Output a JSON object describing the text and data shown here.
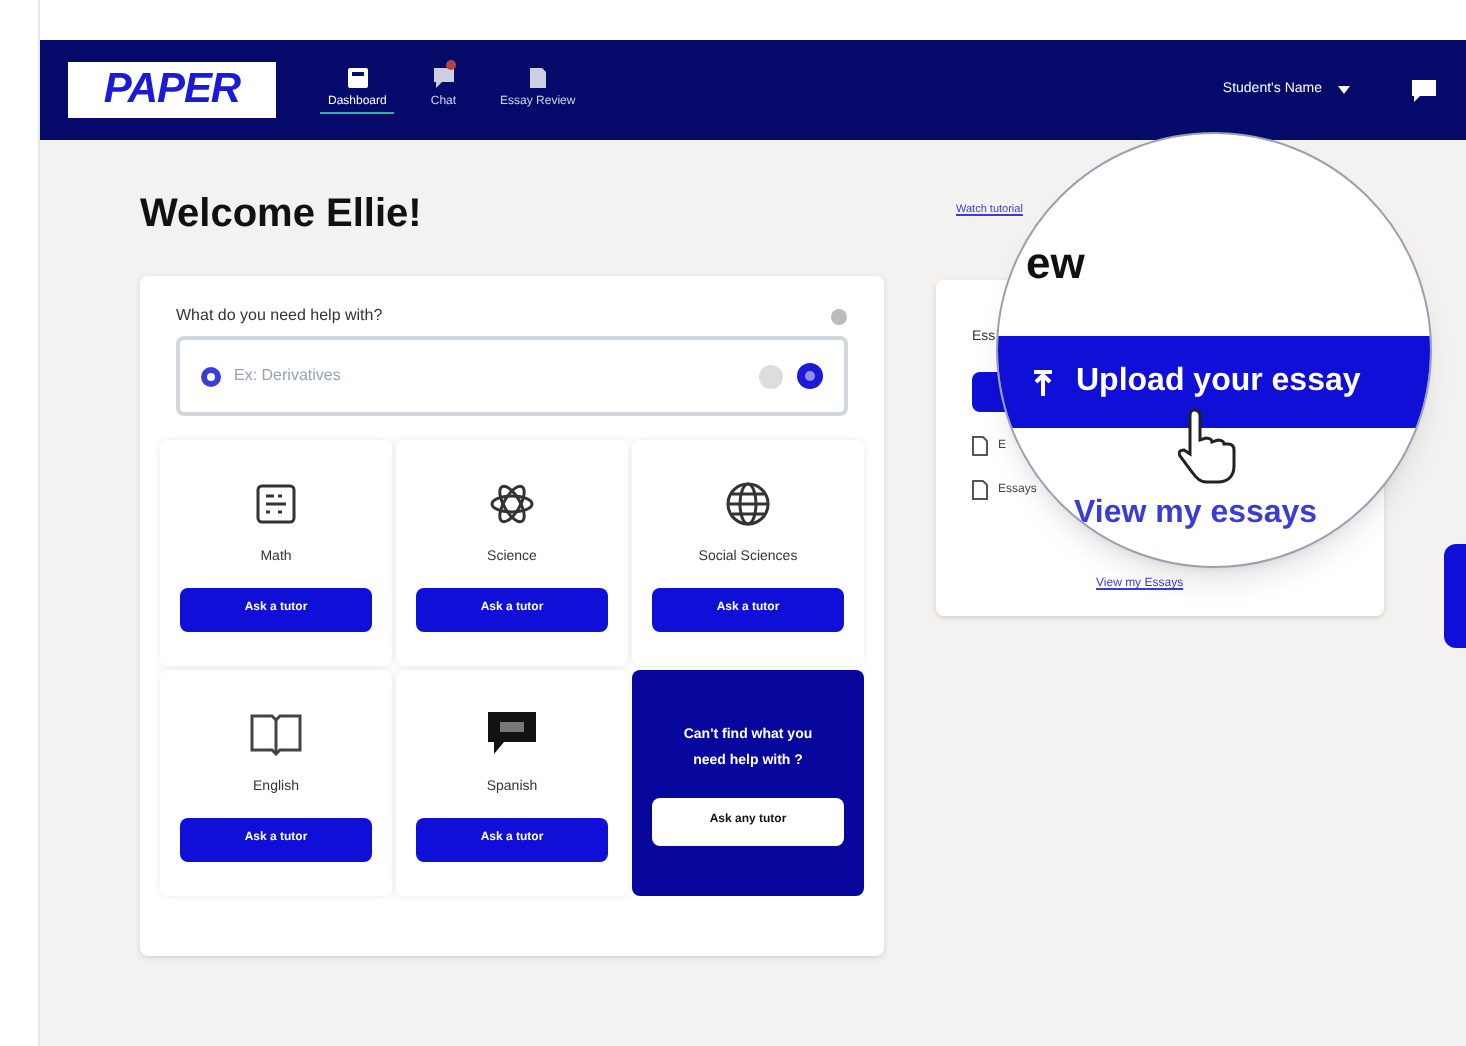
{
  "nav": {
    "logo": "PAPER",
    "items": [
      {
        "label": "Dashboard",
        "selected": true,
        "badge": false,
        "kind": "home"
      },
      {
        "label": "Chat",
        "selected": false,
        "badge": true,
        "kind": "chat"
      },
      {
        "label": "Essay Review",
        "selected": false,
        "badge": false,
        "kind": "doc"
      }
    ],
    "user_menu": "Student's Name"
  },
  "welcome": "Welcome Ellie!",
  "help": {
    "prompt": "What do you need help with?",
    "placeholder": "Ex: Derivatives",
    "subjects": [
      {
        "name": "Math",
        "button": "Ask a tutor",
        "kind": "math"
      },
      {
        "name": "Science",
        "button": "Ask a tutor",
        "kind": "science"
      },
      {
        "name": "Social Sciences",
        "button": "Ask a tutor",
        "kind": "globe"
      },
      {
        "name": "English",
        "button": "Ask a tutor",
        "kind": "book"
      },
      {
        "name": "Spanish",
        "button": "Ask a tutor",
        "kind": "speech"
      }
    ],
    "fallback": {
      "text": "Can't find what you need help with ?",
      "button": "Ask any tutor"
    }
  },
  "tutorial_link": "Watch tutorial",
  "essay_card": {
    "label": "Ess",
    "docs": [
      "E",
      "Essays"
    ],
    "link": "View my Essays"
  },
  "magnifier": {
    "title": "ew",
    "upload": "Upload your essay",
    "link": "View my essays"
  }
}
